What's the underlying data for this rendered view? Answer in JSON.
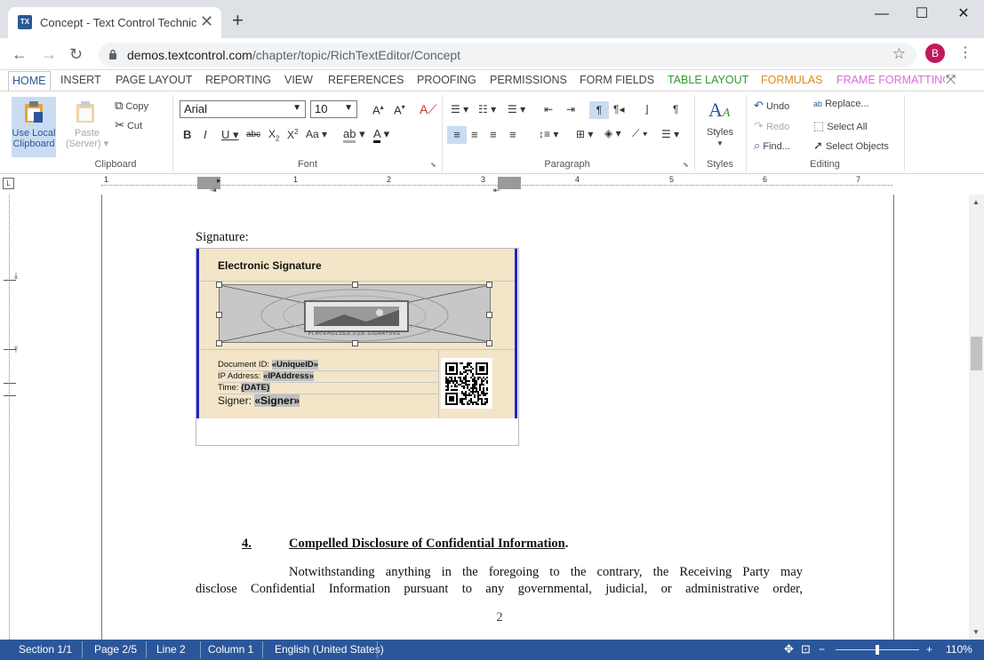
{
  "browser": {
    "tab_title": "Concept - Text Control Technical",
    "tab_favicon": "TX",
    "url_host": "demos.textcontrol.com",
    "url_path": "/chapter/topic/RichTextEditor/Concept",
    "avatar_letter": "B",
    "buttons": {
      "close_tab": "✕",
      "new_tab": "+",
      "back": "←",
      "forward": "→",
      "reload": "↻",
      "star": "☆",
      "menu": "⋮",
      "minimize": "—",
      "maximize": "☐",
      "close": "✕"
    }
  },
  "ribbon_tabs": [
    {
      "label": "HOME"
    },
    {
      "label": "INSERT"
    },
    {
      "label": "PAGE LAYOUT"
    },
    {
      "label": "REPORTING"
    },
    {
      "label": "VIEW"
    },
    {
      "label": "REFERENCES"
    },
    {
      "label": "PROOFING"
    },
    {
      "label": "PERMISSIONS"
    },
    {
      "label": "FORM FIELDS"
    },
    {
      "label": "TABLE LAYOUT"
    },
    {
      "label": "FORMULAS"
    },
    {
      "label": "FRAME FORMATTING"
    }
  ],
  "ribbon_tab_colors": {
    "table_layout": "#2e9b2e",
    "formulas": "#e08a1e",
    "frame_formatting": "#d670d6"
  },
  "clipboard": {
    "group": "Clipboard",
    "use_local_line1": "Use Local",
    "use_local_line2": "Clipboard",
    "paste_line1": "Paste",
    "paste_line2": "(Server)",
    "copy": "Copy",
    "cut": "Cut"
  },
  "font": {
    "group": "Font",
    "family": "Arial",
    "size": "10"
  },
  "paragraph": {
    "group": "Paragraph"
  },
  "styles": {
    "group": "Styles",
    "label": "Styles"
  },
  "editing": {
    "group": "Editing",
    "undo": "Undo",
    "redo": "Redo",
    "find": "Find...",
    "replace": "Replace...",
    "select_all": "Select All",
    "select_objects": "Select Objects"
  },
  "ruler_numbers": [
    "1",
    "1",
    "2",
    "3",
    "4",
    "5",
    "6",
    "7"
  ],
  "document": {
    "signature_label": "Signature:",
    "sig_title": "Electronic Signature",
    "doc_id_label": "Document ID: ",
    "doc_id_field": "«UniqueID»",
    "ip_label": "IP Address: ",
    "ip_field": "«IPAddress»",
    "time_label": "Time: ",
    "time_field": "{DATE}",
    "signer_label": "Signer: ",
    "signer_field": "«Signer»",
    "placeholder_text": "PLACEHOLDER FOR SIGNATURE",
    "section_number": "4.",
    "section_title": "Compelled Disclosure of Confidential Information",
    "section_period": ".",
    "para_line1": "Notwithstanding anything in the foregoing to the contrary, the Receiving Party may",
    "para_line2": "disclose Confidential Information pursuant to any governmental, judicial, or administrative order,",
    "page_number": "2"
  },
  "status": {
    "section": "Section 1/1",
    "page": "Page 2/5",
    "line": "Line 2",
    "column": "Column 1",
    "language": "English (United States)",
    "zoom": "110%",
    "zoom_minus": "−",
    "zoom_plus": "+"
  }
}
